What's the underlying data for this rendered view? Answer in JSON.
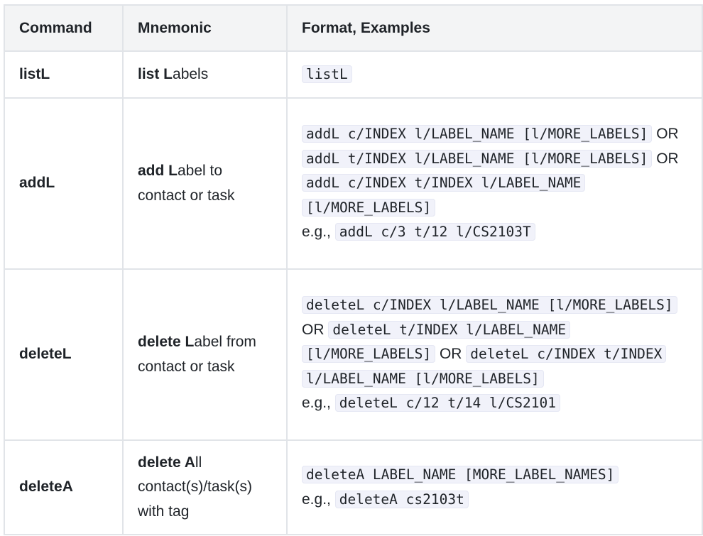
{
  "headers": {
    "command": "Command",
    "mnemonic": "Mnemonic",
    "format": "Format, Examples"
  },
  "rows": [
    {
      "command": "listL",
      "mnemonic_bold": "list L",
      "mnemonic_rest": "abels",
      "format_code_1": "listL"
    },
    {
      "command": "addL",
      "mnemonic_bold": "add L",
      "mnemonic_rest": "abel to contact or task",
      "format_code_1": "addL c/INDEX l/LABEL_NAME [l/MORE_LABELS]",
      "or_1": "OR",
      "format_code_2": "addL t/INDEX l/LABEL_NAME [l/MORE_LABELS]",
      "or_2": "OR",
      "format_code_3": "addL c/INDEX t/INDEX l/LABEL_NAME [l/MORE_LABELS]",
      "example_prefix": "e.g.,",
      "example_code": "addL c/3 t/12 l/CS2103T"
    },
    {
      "command": "deleteL",
      "mnemonic_bold": "delete L",
      "mnemonic_rest": "abel from contact or task",
      "format_code_1": "deleteL c/INDEX l/LABEL_NAME [l/MORE_LABELS]",
      "or_1": "OR",
      "format_code_2": "deleteL t/INDEX l/LABEL_NAME [l/MORE_LABELS]",
      "or_2": "OR",
      "format_code_3": "deleteL c/INDEX t/INDEX l/LABEL_NAME [l/MORE_LABELS]",
      "example_prefix": "e.g.,",
      "example_code": "deleteL c/12 t/14 l/CS2101"
    },
    {
      "command": "deleteA",
      "mnemonic_bold": "delete A",
      "mnemonic_rest": "ll contact(s)/task(s) with tag",
      "format_code_1": "deleteA LABEL_NAME [MORE_LABEL_NAMES]",
      "example_prefix": "e.g.,",
      "example_code": "deleteA cs2103t"
    }
  ]
}
